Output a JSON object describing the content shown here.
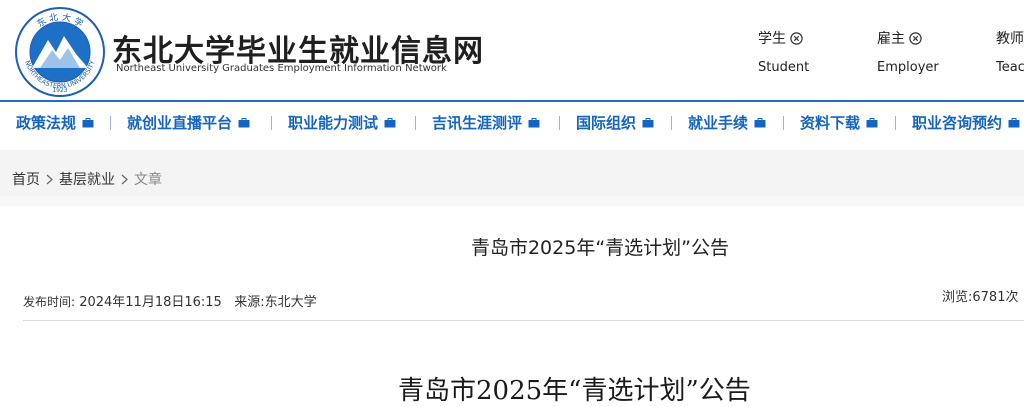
{
  "site": {
    "title_cn": "东北大学毕业生就业信息网",
    "title_en": "Northeast University Graduates Employment Information Network",
    "emblem_top_text": "东 北 大 学",
    "emblem_bottom_text": "NORTHEASTERN UNIVERSITY",
    "emblem_year": "1923",
    "logo_icon": "university-emblem-icon"
  },
  "roles": [
    {
      "cn": "学生",
      "en": "Student"
    },
    {
      "cn": "雇主",
      "en": "Employer"
    },
    {
      "cn": "教师",
      "en": "Teac"
    }
  ],
  "nav": {
    "items": [
      {
        "label": "政策法规"
      },
      {
        "label": "就创业直播平台"
      },
      {
        "label": "职业能力测试"
      },
      {
        "label": "吉讯生涯测评"
      },
      {
        "label": "国际组织"
      },
      {
        "label": "就业手续"
      },
      {
        "label": "资料下载"
      },
      {
        "label": "职业咨询预约"
      }
    ],
    "accent_color": "#1565c0"
  },
  "breadcrumb": {
    "items": [
      "首页",
      "基层就业"
    ],
    "current": "文章"
  },
  "article": {
    "title": "青岛市2025年“青选计划”公告",
    "publish_label": "发布时间:",
    "publish_time": "2024年11月18日16:15",
    "source_label": "来源:",
    "source": "东北大学",
    "views_label": "浏览:",
    "views": "6781次",
    "body_title": "青岛市2025年“青选计划”公告"
  }
}
